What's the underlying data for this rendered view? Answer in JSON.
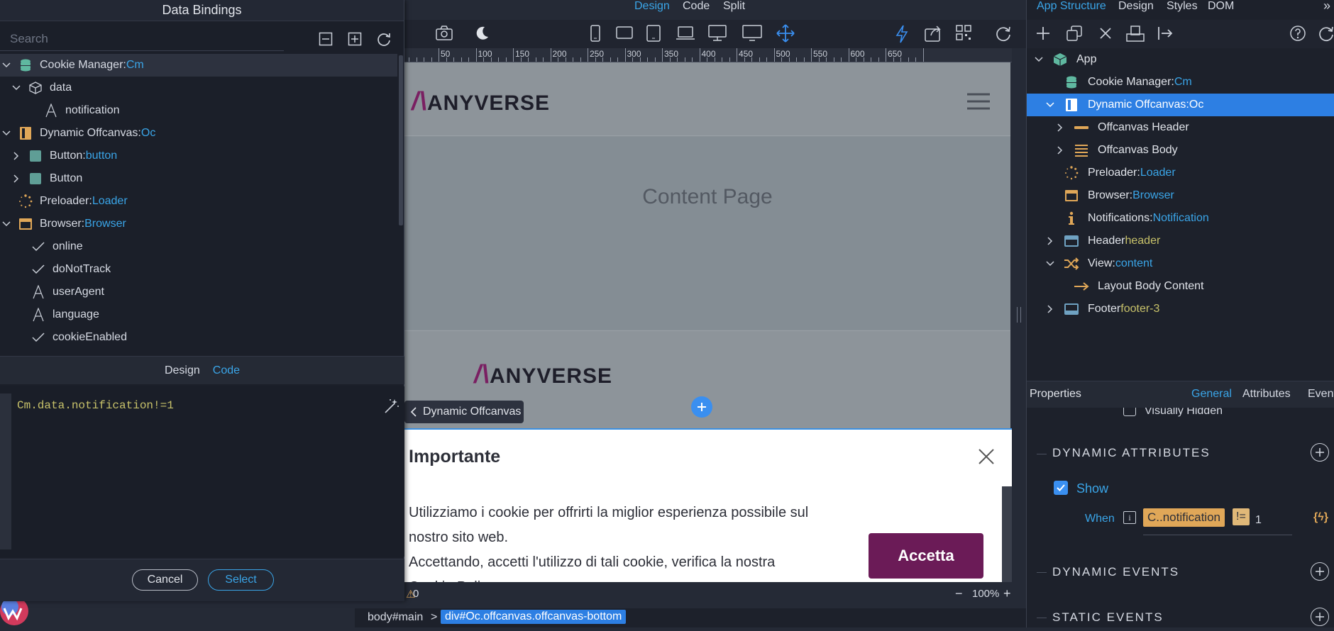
{
  "dialog": {
    "title": "Data Bindings",
    "search_placeholder": "Search",
    "tree": [
      {
        "label": "Cookie Manager: ",
        "value": "Cm"
      },
      {
        "label": "data",
        "value": ""
      },
      {
        "label": "notification",
        "value": ""
      },
      {
        "label": "Dynamic Offcanvas: ",
        "value": "Oc"
      },
      {
        "label": "Button: ",
        "value": "button"
      },
      {
        "label": "Button",
        "value": ""
      },
      {
        "label": "Preloader: ",
        "value": "Loader"
      },
      {
        "label": "Browser: ",
        "value": "Browser"
      },
      {
        "label": "online",
        "value": ""
      },
      {
        "label": "doNotTrack",
        "value": ""
      },
      {
        "label": "userAgent",
        "value": ""
      },
      {
        "label": "language",
        "value": ""
      },
      {
        "label": "cookieEnabled",
        "value": ""
      }
    ],
    "tabs": {
      "design": "Design",
      "code": "Code"
    },
    "code": "Cm.data.notification!=1",
    "cancel": "Cancel",
    "select": "Select"
  },
  "topbar": {
    "design": "Design",
    "code": "Code",
    "split": "Split"
  },
  "ruler": [
    "50",
    "100",
    "150",
    "200",
    "250",
    "300",
    "350",
    "400",
    "450",
    "500",
    "550",
    "600",
    "650"
  ],
  "canvas": {
    "logo": "ANYVERSE",
    "content_title": "Content Page",
    "offcanvas_badge": "Dynamic Offcanvas",
    "offcanvas_title": "Importante",
    "offcanvas_text_1": "Utilizziamo i cookie per offrirti la miglior esperienza possibile sul",
    "offcanvas_text_2": "nostro sito web.",
    "offcanvas_text_3": "Accettando, accetti l'utilizzo di tali cookie, verifica la nostra",
    "offcanvas_text_4": "Cookie Policy",
    "accept": "Accetta"
  },
  "zoom": {
    "warnings": "0",
    "level": "100%"
  },
  "breadcrumb": {
    "body": "body#main",
    "sep": ">",
    "active": "div#Oc.offcanvas.offcanvas-bottom"
  },
  "right": {
    "tabs": {
      "app_structure": "App Structure",
      "design": "Design",
      "styles": "Styles",
      "dom": "DOM"
    },
    "structure": [
      {
        "label": "App",
        "value": ""
      },
      {
        "label": "Cookie Manager: ",
        "value": "Cm"
      },
      {
        "label": "Dynamic Offcanvas: ",
        "value": "Oc"
      },
      {
        "label": "Offcanvas Header",
        "value": ""
      },
      {
        "label": "Offcanvas Body",
        "value": ""
      },
      {
        "label": "Preloader: ",
        "value": "Loader"
      },
      {
        "label": "Browser: ",
        "value": "Browser"
      },
      {
        "label": "Notifications: ",
        "value": "Notification"
      },
      {
        "label": "Header ",
        "value": "header"
      },
      {
        "label": "View: ",
        "value": "content"
      },
      {
        "label": "Layout Body Content",
        "value": ""
      },
      {
        "label": "Footer ",
        "value": "footer-3"
      }
    ],
    "properties": {
      "title": "Properties",
      "tabs": {
        "general": "General",
        "attributes": "Attributes",
        "events": "Events"
      },
      "visually_hidden": "Visually Hidden",
      "dynamic_attributes": "DYNAMIC ATTRIBUTES",
      "show": "Show",
      "when": "When",
      "expr_left": "C..notification",
      "expr_op": "!=",
      "expr_right": "1",
      "dynamic_events": "DYNAMIC EVENTS",
      "static_events": "STATIC EVENTS"
    }
  }
}
